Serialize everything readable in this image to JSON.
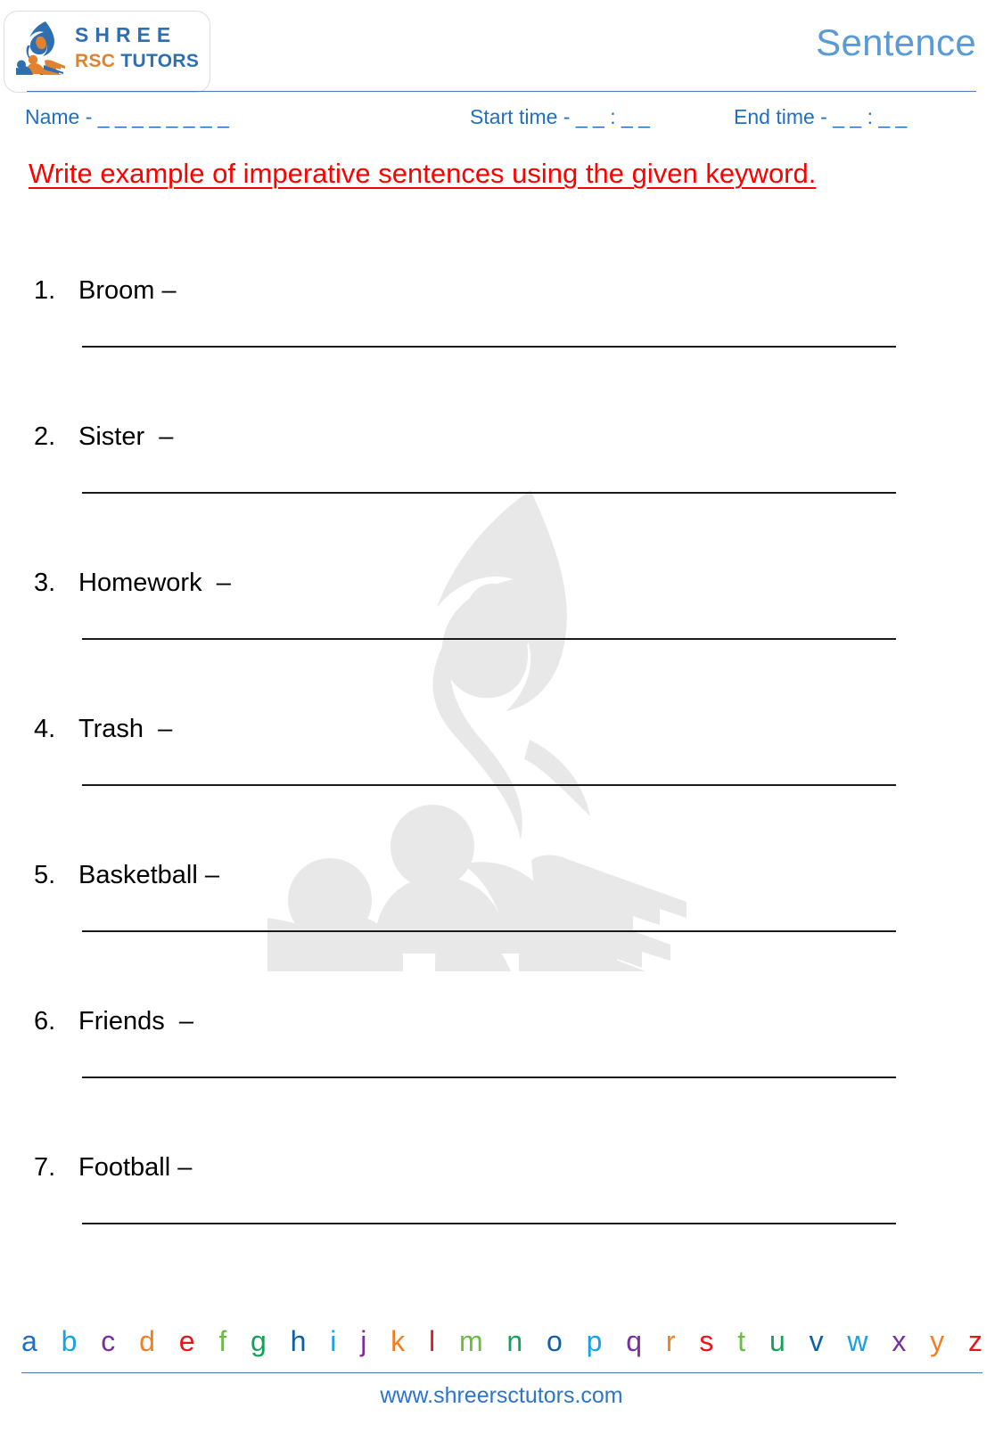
{
  "header": {
    "logo_shree": "SHREE",
    "logo_rsc": "RSC",
    "logo_tutors": " TUTORS",
    "logo_icon": "flame-book-logo-icon",
    "title": "Sentence",
    "title_color": "#5b9bd5",
    "rule_color": "#4a77b5"
  },
  "meta": {
    "name_label": "Name - _ _ _ _ _ _ _ _",
    "start_time_label": "Start time - _ _ : _ _",
    "end_time_label": "End time - _ _ : _ _",
    "color": "#1f6fc4"
  },
  "instruction": {
    "text": "Write example of imperative sentences using the given keyword.",
    "color": "#ff0000"
  },
  "questions": [
    {
      "number": "1.",
      "keyword": "Broom –",
      "answer": ""
    },
    {
      "number": "2.",
      "keyword": "Sister  –",
      "answer": ""
    },
    {
      "number": "3.",
      "keyword": "Homework  –",
      "answer": ""
    },
    {
      "number": "4.",
      "keyword": "Trash  –",
      "answer": ""
    },
    {
      "number": "5.",
      "keyword": "Basketball –",
      "answer": ""
    },
    {
      "number": "6.",
      "keyword": "Friends  –",
      "answer": ""
    },
    {
      "number": "7.",
      "keyword": "Football –",
      "answer": ""
    }
  ],
  "alphabet": {
    "letters": [
      "a",
      "b",
      "c",
      "d",
      "e",
      "f",
      "g",
      "h",
      "i",
      "j",
      "k",
      "l",
      "m",
      "n",
      "o",
      "p",
      "q",
      "r",
      "s",
      "t",
      "u",
      "v",
      "w",
      "x",
      "y",
      "z"
    ],
    "colors": [
      "#1f6fc4",
      "#18a0e8",
      "#7a2f9e",
      "#ef7f23",
      "#e8161a",
      "#6cbb45",
      "#17a05a",
      "#0f5fa8",
      "#18a0e8",
      "#7a2f9e",
      "#ef7f23",
      "#e8161a",
      "#6cbb45",
      "#17a05a",
      "#0f5fa8",
      "#18a0e8",
      "#7a2f9e",
      "#ef7f23",
      "#e8161a",
      "#6cbb45",
      "#17a05a",
      "#0f5fa8",
      "#18a0e8",
      "#7a2f9e",
      "#ef7f23",
      "#e8161a"
    ]
  },
  "footer": {
    "url": "www.shreersctutors.com",
    "color": "#2e74c9"
  },
  "watermark": {
    "icon": "flame-book-watermark-icon",
    "color": "#e8e8e8"
  }
}
